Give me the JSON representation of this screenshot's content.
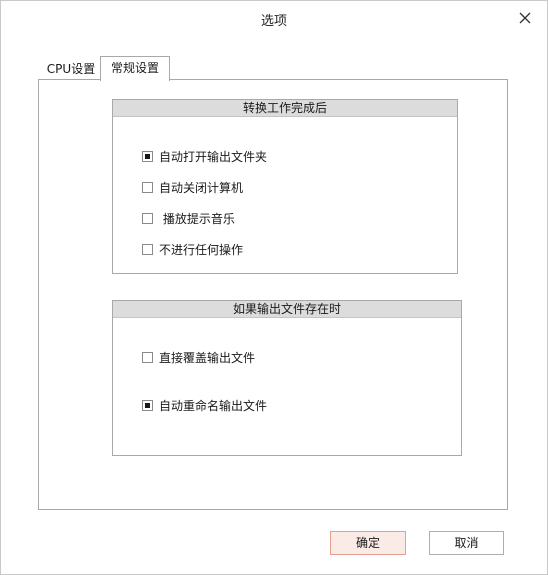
{
  "window": {
    "title": "选项"
  },
  "tabs": [
    {
      "label": "CPU设置",
      "active": false
    },
    {
      "label": "常规设置",
      "active": true
    }
  ],
  "group_after_convert": {
    "header": "转换工作完成后",
    "options": [
      {
        "label": "自动打开输出文件夹",
        "checked": true
      },
      {
        "label": "自动关闭计算机",
        "checked": false
      },
      {
        "label": " 播放提示音乐",
        "checked": false
      },
      {
        "label": "不进行任何操作",
        "checked": false
      }
    ]
  },
  "group_file_exists": {
    "header": "如果输出文件存在时",
    "options": [
      {
        "label": "直接覆盖输出文件",
        "checked": false
      },
      {
        "label": "自动重命名输出文件",
        "checked": true
      }
    ]
  },
  "buttons": {
    "ok_label": "确定",
    "cancel_label": "取消"
  },
  "icons": {
    "close": "close-icon"
  },
  "colors": {
    "ok_border": "#e2a08d",
    "ok_background": "#fbebe6",
    "group_header_background": "#dcdcdc"
  }
}
